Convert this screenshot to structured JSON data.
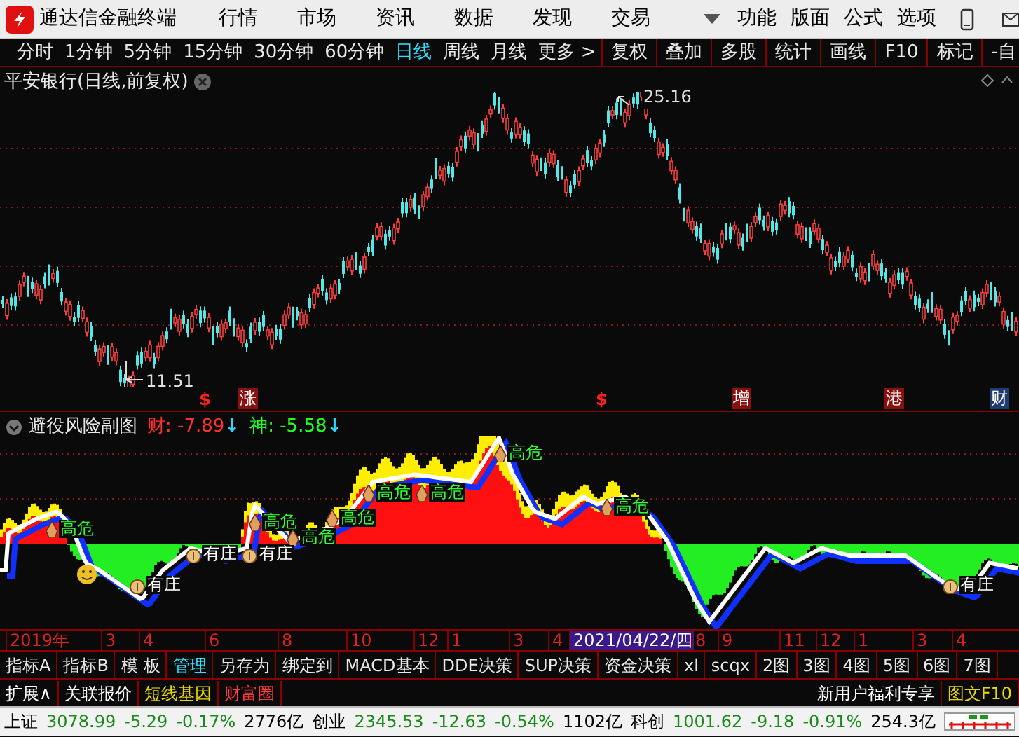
{
  "menu_bar": {
    "app_title": "通达信金融终端",
    "items": [
      "行情",
      "市场",
      "资讯",
      "数据",
      "发现",
      "交易"
    ],
    "right_items": [
      "功能",
      "版面",
      "公式",
      "选项"
    ]
  },
  "period_bar": {
    "periods": [
      {
        "label": "分时",
        "selected": false
      },
      {
        "label": "1分钟",
        "selected": false
      },
      {
        "label": "5分钟",
        "selected": false
      },
      {
        "label": "15分钟",
        "selected": false
      },
      {
        "label": "30分钟",
        "selected": false
      },
      {
        "label": "60分钟",
        "selected": false
      },
      {
        "label": "日线",
        "selected": true
      },
      {
        "label": "周线",
        "selected": false
      },
      {
        "label": "月线",
        "selected": false
      },
      {
        "label": "更多 >",
        "selected": false
      }
    ],
    "buttons": [
      "复权",
      "叠加",
      "多股",
      "统计",
      "画线",
      "F10",
      "标记",
      "-自"
    ]
  },
  "price_chart": {
    "title": "平安银行(日线,前复权)",
    "high_label": "25.16",
    "low_label": "11.51",
    "markers": [
      {
        "kind": "dollar",
        "text": "$",
        "color": "#ff2020"
      },
      {
        "kind": "tag",
        "text": "涨",
        "color": "#8a1010"
      },
      {
        "kind": "dollar",
        "text": "$",
        "color": "#ff2020"
      },
      {
        "kind": "tag",
        "text": "增",
        "color": "#8a1010"
      },
      {
        "kind": "tag",
        "text": "港",
        "color": "#8a1010"
      },
      {
        "kind": "tag",
        "text": "财",
        "color": "#1e3d6e"
      }
    ]
  },
  "indicator": {
    "title": "避役风险副图",
    "values": [
      {
        "name": "财:",
        "value": "-7.89",
        "arrow": "↓",
        "color": "#ff3030"
      },
      {
        "name": "神:",
        "value": "-5.58",
        "arrow": "↓",
        "color": "#20ff20"
      }
    ],
    "annotations": [
      {
        "kind": "danger",
        "text": "高危"
      },
      {
        "kind": "danger",
        "text": "高危"
      },
      {
        "kind": "danger",
        "text": "高危"
      },
      {
        "kind": "danger",
        "text": "高危"
      },
      {
        "kind": "danger",
        "text": "高危"
      },
      {
        "kind": "danger",
        "text": "高危"
      },
      {
        "kind": "danger",
        "text": "高危"
      },
      {
        "kind": "danger",
        "text": "高危"
      },
      {
        "kind": "banker",
        "text": "有庄"
      },
      {
        "kind": "banker",
        "text": "有庄"
      },
      {
        "kind": "banker",
        "text": "有庄"
      },
      {
        "kind": "banker",
        "text": "有庄"
      }
    ]
  },
  "time_axis": [
    {
      "label": "2019年",
      "selected": false
    },
    {
      "label": "3",
      "selected": false
    },
    {
      "label": "4",
      "selected": false
    },
    {
      "label": "6",
      "selected": false
    },
    {
      "label": "8",
      "selected": false
    },
    {
      "label": "10",
      "selected": false
    },
    {
      "label": "12",
      "selected": false
    },
    {
      "label": "1",
      "selected": false
    },
    {
      "label": "3",
      "selected": false
    },
    {
      "label": "4",
      "selected": false
    },
    {
      "label": "2021/04/22/四",
      "selected": true
    },
    {
      "label": "8",
      "selected": false
    },
    {
      "label": "9",
      "selected": false
    },
    {
      "label": "11",
      "selected": false
    },
    {
      "label": "12",
      "selected": false
    },
    {
      "label": "1",
      "selected": false
    },
    {
      "label": "3",
      "selected": false
    },
    {
      "label": "4",
      "selected": false
    }
  ],
  "indicator_tabs": [
    {
      "label": "指标A",
      "selected": false
    },
    {
      "label": "指标B",
      "selected": false
    },
    {
      "label": "模 板",
      "selected": false
    },
    {
      "label": "管理",
      "selected": true
    },
    {
      "label": "另存为",
      "selected": false
    },
    {
      "label": "绑定到",
      "selected": false
    },
    {
      "label": "MACD基本",
      "selected": false
    },
    {
      "label": "DDE决策",
      "selected": false
    },
    {
      "label": "SUP决策",
      "selected": false
    },
    {
      "label": "资金决策",
      "selected": false
    },
    {
      "label": "xl",
      "selected": false
    },
    {
      "label": "scqx",
      "selected": false
    },
    {
      "label": "2图",
      "selected": false
    },
    {
      "label": "3图",
      "selected": false
    },
    {
      "label": "4图",
      "selected": false
    },
    {
      "label": "5图",
      "selected": false
    },
    {
      "label": "6图",
      "selected": false
    },
    {
      "label": "7图",
      "selected": false
    }
  ],
  "extra_bar": {
    "left": [
      {
        "label": "扩展∧",
        "kind": "normal"
      },
      {
        "label": "关联报价",
        "kind": "normal"
      },
      {
        "label": "短线基因",
        "kind": "highlight"
      },
      {
        "label": "财富圈",
        "kind": "alert"
      }
    ],
    "right": [
      {
        "label": "新用户福利专享",
        "kind": "normal"
      },
      {
        "label": "图文F10",
        "kind": "highlight"
      }
    ]
  },
  "status_bar": [
    {
      "name": "上证",
      "price": "3078.99",
      "change": "-5.29",
      "percent": "-0.17%",
      "amount": "2776亿"
    },
    {
      "name": "创业",
      "price": "2345.53",
      "change": "-12.63",
      "percent": "-0.54%",
      "amount": "1102亿"
    },
    {
      "name": "科创",
      "price": "1001.62",
      "change": "-9.18",
      "percent": "-0.91%",
      "amount": "254.3亿"
    }
  ]
}
